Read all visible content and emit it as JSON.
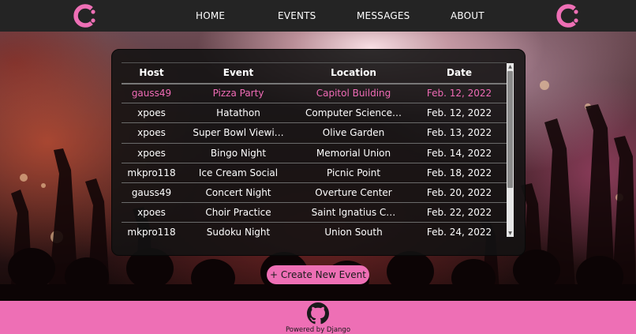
{
  "nav": {
    "logo_left_icon": "brand-logo-c",
    "logo_right_icon": "brand-logo-c",
    "links": [
      {
        "label": "HOME"
      },
      {
        "label": "EVENTS"
      },
      {
        "label": "MESSAGES"
      },
      {
        "label": "ABOUT"
      }
    ]
  },
  "events_table": {
    "headers": [
      "Host",
      "Event",
      "Location",
      "Date"
    ],
    "highlight_color": "#f06bb6",
    "rows": [
      {
        "host": "gauss49",
        "event": "Pizza Party",
        "location": "Capitol Building",
        "date": "Feb. 12, 2022",
        "highlighted": true
      },
      {
        "host": "xpoes",
        "event": "Hatathon",
        "location": "Computer Science…",
        "date": "Feb. 12, 2022",
        "highlighted": false
      },
      {
        "host": "xpoes",
        "event": "Super Bowl Viewi…",
        "location": "Olive Garden",
        "date": "Feb. 13, 2022",
        "highlighted": false
      },
      {
        "host": "xpoes",
        "event": "Bingo Night",
        "location": "Memorial Union",
        "date": "Feb. 14, 2022",
        "highlighted": false
      },
      {
        "host": "mkpro118",
        "event": "Ice Cream Social",
        "location": "Picnic Point",
        "date": "Feb. 18, 2022",
        "highlighted": false
      },
      {
        "host": "gauss49",
        "event": "Concert Night",
        "location": "Overture Center",
        "date": "Feb. 20, 2022",
        "highlighted": false
      },
      {
        "host": "xpoes",
        "event": "Choir Practice",
        "location": "Saint Ignatius C…",
        "date": "Feb. 22, 2022",
        "highlighted": false
      },
      {
        "host": "mkpro118",
        "event": "Sudoku Night",
        "location": "Union South",
        "date": "Feb. 24, 2022",
        "highlighted": false
      }
    ]
  },
  "create_button": {
    "label": "+ Create New Event"
  },
  "footer": {
    "icon": "github-icon",
    "powered_by": "Powered by Django"
  },
  "colors": {
    "accent": "#ee6fb5",
    "navbar": "#242424",
    "panel": "#121212"
  }
}
